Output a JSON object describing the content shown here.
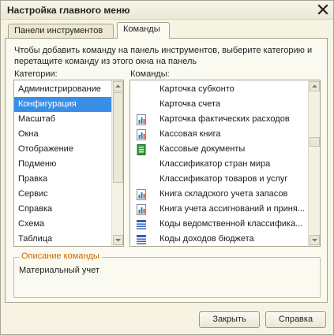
{
  "window": {
    "title": "Настройка главного меню"
  },
  "tabs": [
    {
      "label": "Панели инструментов",
      "active": false
    },
    {
      "label": "Команды",
      "active": true
    }
  ],
  "hint": "Чтобы добавить команду на панель инструментов, выберите категорию и перетащите команду из этого окна на панель",
  "categories": {
    "label": "Категории:",
    "selected": "Конфигурация",
    "items": [
      "Администрирование",
      "Конфигурация",
      "Масштаб",
      "Окна",
      "Отображение",
      "Подменю",
      "Правка",
      "Сервис",
      "Справка",
      "Схема",
      "Таблица"
    ]
  },
  "commands": {
    "label": "Команды:",
    "items": [
      {
        "label": "Карточка субконто",
        "icon": "none"
      },
      {
        "label": "Карточка счета",
        "icon": "none"
      },
      {
        "label": "Карточка фактических расходов",
        "icon": "report-icon"
      },
      {
        "label": "Кассовая книга",
        "icon": "report-icon"
      },
      {
        "label": "Кассовые документы",
        "icon": "journal-icon"
      },
      {
        "label": "Классификатор стран мира",
        "icon": "none"
      },
      {
        "label": "Классификатор товаров и услуг",
        "icon": "none"
      },
      {
        "label": "Книга складского учета запасов",
        "icon": "report-icon"
      },
      {
        "label": "Книга учета ассигнований и приня...",
        "icon": "report-icon"
      },
      {
        "label": "Коды ведомственной классифика...",
        "icon": "code-list-icon"
      },
      {
        "label": "Коды доходов бюджета",
        "icon": "code-list-icon"
      }
    ]
  },
  "description": {
    "legend": "Описание команды",
    "text": "Материальный учет"
  },
  "buttons": {
    "close": "Закрыть",
    "help": "Справка"
  },
  "colors": {
    "selection": "#3a8ee6",
    "legend": "#c76a00",
    "panel": "#f6f3e2"
  }
}
